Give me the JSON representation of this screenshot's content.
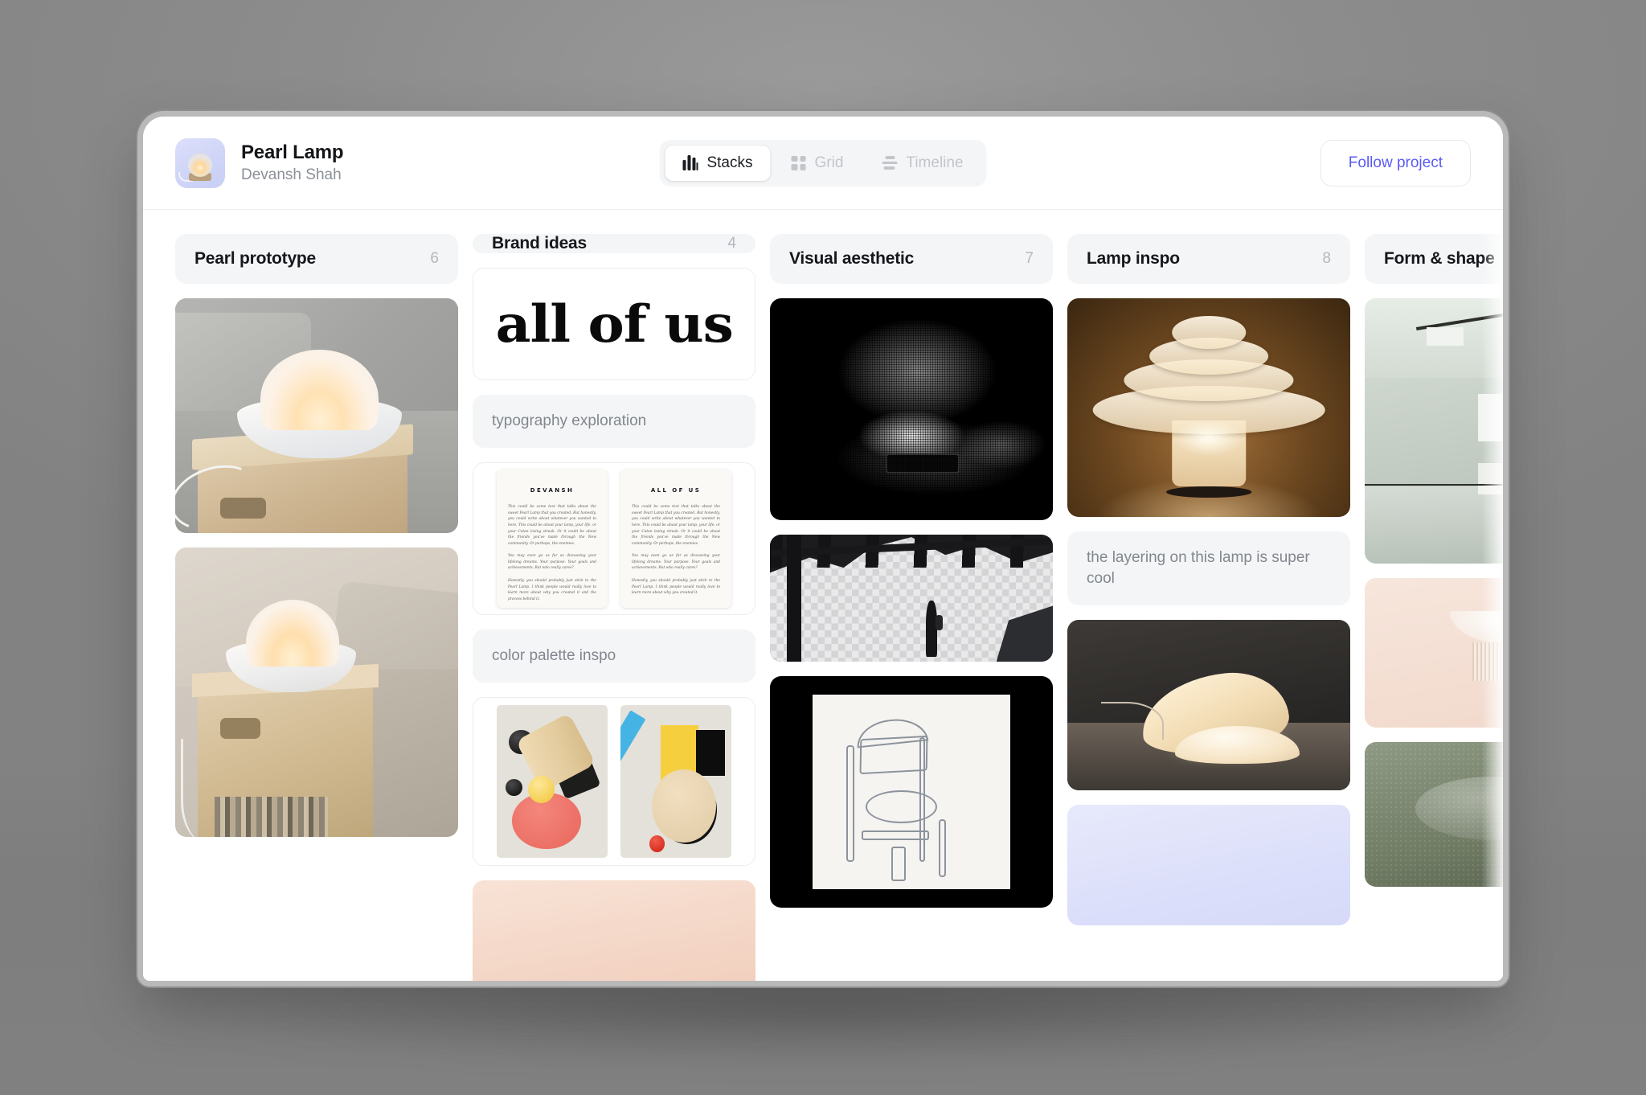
{
  "header": {
    "project_title": "Pearl Lamp",
    "project_owner": "Devansh Shah",
    "avatar_icon": "pearl-lamp-thumbnail",
    "follow_label": "Follow project",
    "accent_color": "#5b5bf5",
    "views": [
      {
        "label": "Stacks",
        "icon": "stacks-icon",
        "active": true
      },
      {
        "label": "Grid",
        "icon": "grid-icon",
        "active": false
      },
      {
        "label": "Timeline",
        "icon": "timeline-icon",
        "active": false
      }
    ]
  },
  "board": {
    "columns": [
      {
        "title": "Pearl prototype",
        "count": "6",
        "cards": [
          {
            "type": "image",
            "alt": "glowing pearl lamp on wooden crate beside gray sofa"
          },
          {
            "type": "image",
            "alt": "pearl lamp on wooden stool with books and cushions"
          }
        ]
      },
      {
        "title": "Brand ideas",
        "count": "4",
        "cards": [
          {
            "type": "image",
            "alt": "bold serif wordmark",
            "caption": "all of us"
          },
          {
            "type": "note",
            "text": "typography exploration"
          },
          {
            "type": "image",
            "alt": "two letterhead mockups",
            "letters": [
              {
                "heading": "DEVANSH",
                "paragraphs": [
                  "This could be some text that talks about the sweet Pearl Lamp that you created. But honestly, you could write about whatever you wanted to here. This could be about your lamp, your life, or your Catan losing streak. Or it could be about the friends you've made through the New community. Or perhaps, the enemies.",
                  "You may even go as far as discussing your lifelong dreams. Your purpose. Your goals and achievements. But who really cares?",
                  "Honestly, you should probably just stick to the Pearl Lamp. I think people would really love to learn more about why you created it and the process behind it."
                ]
              },
              {
                "heading": "ALL OF US",
                "paragraphs": [
                  "This could be some text that talks about the sweet Pearl Lamp that you created. But honestly, you could write about whatever you wanted to here. This could be about your lamp, your life, or your Catan losing streak. Or it could be about the friends you've made through the New community. Or perhaps, the enemies.",
                  "You may even go as far as discussing your lifelong dreams. Your purpose. Your goals and achievements. But who really cares?",
                  "Honestly, you should probably just stick to the Pearl Lamp. I think people would really love to learn more about why you created it."
                ]
              }
            ]
          },
          {
            "type": "note",
            "text": "color palette inspo"
          },
          {
            "type": "image",
            "alt": "two bauhaus style 3d render color studies"
          },
          {
            "type": "image",
            "alt": "peach gradient swatch"
          }
        ]
      },
      {
        "title": "Visual aesthetic",
        "count": "7",
        "cards": [
          {
            "type": "image",
            "alt": "dithered halftone photo of hand holding a phone"
          },
          {
            "type": "image",
            "alt": "white cube installation with lone figure walking"
          },
          {
            "type": "image",
            "alt": "framed pencil sketch of a chair on black background"
          }
        ]
      },
      {
        "title": "Lamp inspo",
        "count": "8",
        "cards": [
          {
            "type": "image",
            "alt": "layered frosted glass lamp glowing amber"
          },
          {
            "type": "note",
            "text": "the layering on this lamp is super cool"
          },
          {
            "type": "image",
            "alt": "curved sculptural lamp casting warm light"
          },
          {
            "type": "image",
            "alt": "lavender gradient swatch"
          }
        ]
      },
      {
        "title": "Form & shape",
        "count": "",
        "cards": [
          {
            "type": "image",
            "alt": "studio interior with pendant lamp and black cable"
          },
          {
            "type": "image",
            "alt": "beige wall sconce with ribbed detail"
          },
          {
            "type": "image",
            "alt": "green textured landscape study"
          }
        ]
      }
    ]
  }
}
